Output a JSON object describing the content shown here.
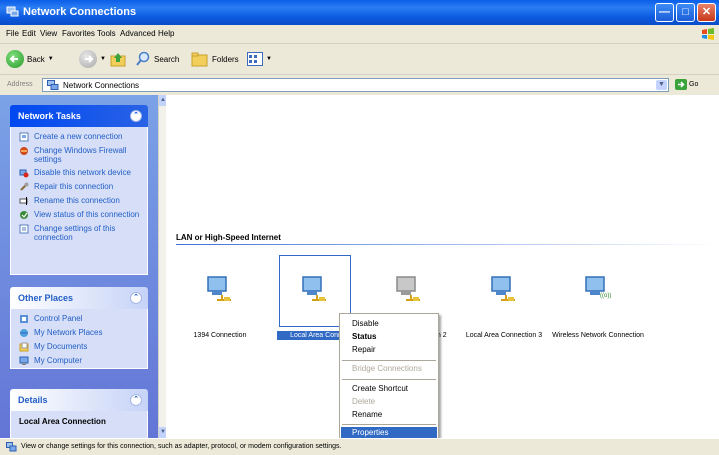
{
  "window": {
    "title": "Network Connections"
  },
  "menu": [
    "File",
    "Edit",
    "View",
    "Favorites",
    "Tools",
    "Advanced",
    "Help"
  ],
  "toolbar": {
    "back": "Back",
    "search": "Search",
    "folders": "Folders"
  },
  "address": {
    "label": "Address",
    "value": "Network Connections",
    "go": "Go"
  },
  "network_tasks": {
    "title": "Network Tasks",
    "items": [
      {
        "label": "Create a new connection",
        "icon": "new-connection-icon"
      },
      {
        "label": "Change Windows Firewall settings",
        "icon": "firewall-icon"
      },
      {
        "label": "Disable this network device",
        "icon": "disable-device-icon"
      },
      {
        "label": "Repair this connection",
        "icon": "repair-icon"
      },
      {
        "label": "Rename this connection",
        "icon": "rename-icon"
      },
      {
        "label": "View status of this connection",
        "icon": "status-icon"
      },
      {
        "label": "Change settings of this connection",
        "icon": "settings-icon"
      }
    ]
  },
  "other_places": {
    "title": "Other Places",
    "items": [
      {
        "label": "Control Panel",
        "icon": "control-panel-icon"
      },
      {
        "label": "My Network Places",
        "icon": "network-places-icon"
      },
      {
        "label": "My Documents",
        "icon": "documents-icon"
      },
      {
        "label": "My Computer",
        "icon": "computer-icon"
      }
    ]
  },
  "details": {
    "title": "Details",
    "name": "Local Area Connection"
  },
  "group": {
    "title": "LAN or High-Speed Internet"
  },
  "connections": [
    {
      "name": "1394 Connection"
    },
    {
      "name": "Local Area Conn"
    },
    {
      "name": "m 2"
    },
    {
      "name": "Local Area Connection 3"
    },
    {
      "name": "Wireless Network Connection",
      "badge": "((o))"
    }
  ],
  "context_menu": {
    "items": [
      "Disable",
      "Status",
      "Repair",
      "Bridge Connections",
      "Create Shortcut",
      "Delete",
      "Rename",
      "Properties"
    ]
  },
  "status": {
    "text": "View or change settings for this connection, such as adapter, protocol, or modem configuration settings."
  },
  "colors": {
    "title_bar": "#0a5ee8",
    "task_pane": "#7ba2e7",
    "selection": "#316ac5",
    "link": "#215dc6"
  }
}
